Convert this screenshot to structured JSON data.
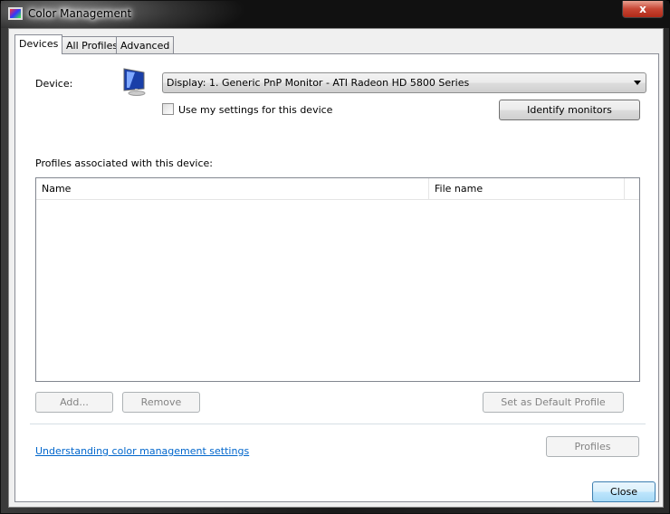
{
  "window": {
    "title": "Color Management",
    "close_glyph": "x"
  },
  "tabs": [
    {
      "label": "Devices",
      "active": true
    },
    {
      "label": "All Profiles",
      "active": false
    },
    {
      "label": "Advanced",
      "active": false
    }
  ],
  "devices": {
    "device_label": "Device:",
    "device_value": "Display: 1. Generic PnP Monitor - ATI Radeon HD 5800 Series",
    "use_settings_label": "Use my settings for this device",
    "use_settings_checked": false,
    "identify_label": "Identify monitors",
    "profiles_label": "Profiles associated with this device:",
    "columns": [
      "Name",
      "File name"
    ],
    "rows": [],
    "add_label": "Add...",
    "remove_label": "Remove",
    "set_default_label": "Set as Default Profile",
    "link_label": "Understanding color management settings",
    "profiles_label_btn": "Profiles"
  },
  "footer": {
    "close_label": "Close"
  }
}
